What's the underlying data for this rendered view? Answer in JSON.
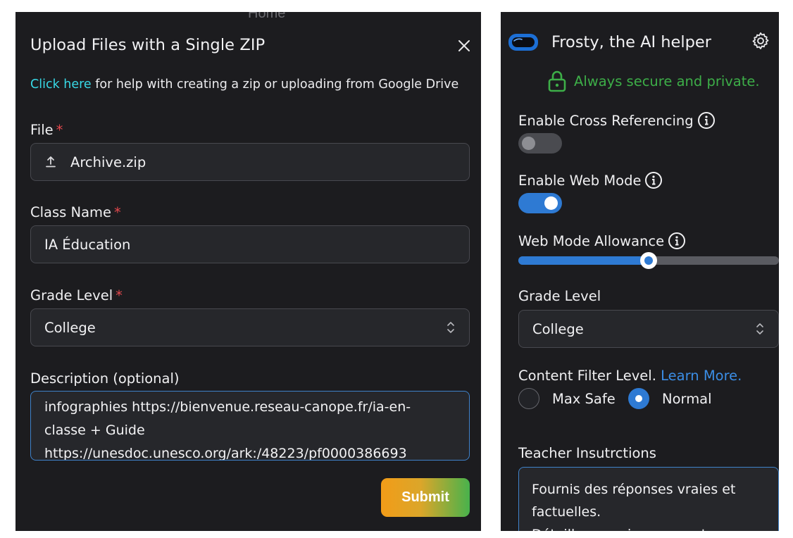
{
  "left": {
    "background_tab": "Home",
    "title": "Upload Files with a Single ZIP",
    "help_link": "Click here",
    "help_text": " for help with creating a zip or uploading from Google Drive",
    "file_label": "File",
    "file_value": "Archive.zip",
    "class_label": "Class Name",
    "class_value": "IA Éducation",
    "grade_label": "Grade Level",
    "grade_value": "College",
    "description_label": "Description (optional)",
    "description_lines": [
      "infographies https://bienvenue.reseau-canope.fr/ia-en-",
      "classe + Guide",
      "https://unesdoc.unesco.org/ark:/48223/pf0000386693"
    ],
    "required_marker": "*",
    "submit_label": "Submit"
  },
  "right": {
    "title": "Frosty, the AI helper",
    "secure_text": "Always secure and private.",
    "cross_ref_label": "Enable Cross Referencing",
    "cross_ref_enabled": false,
    "web_mode_label": "Enable Web Mode",
    "web_mode_enabled": true,
    "allowance_label": "Web Mode Allowance",
    "allowance_value": 0.5,
    "grade_label": "Grade Level",
    "grade_value": "College",
    "filter_label": "Content Filter Level. ",
    "learn_more": "Learn More.",
    "filter_options": [
      "Max Safe",
      "Normal"
    ],
    "filter_selected": "Normal",
    "teacher_label": "Teacher Insutrctions",
    "teacher_lines": [
      "Fournis des réponses vraies et",
      "factuelles.",
      "Détaille ses raisonnements"
    ]
  },
  "colors": {
    "panel_bg": "#1c1c1f",
    "link_cyan": "#38d9e6",
    "accent_blue": "#2e7ad3",
    "secure_green": "#3dae48",
    "required_red": "#e5484d"
  },
  "icons": [
    "close-icon",
    "upload-icon",
    "updown-chevron-icon",
    "goggles-icon",
    "gear-icon",
    "lock-icon",
    "info-icon"
  ]
}
